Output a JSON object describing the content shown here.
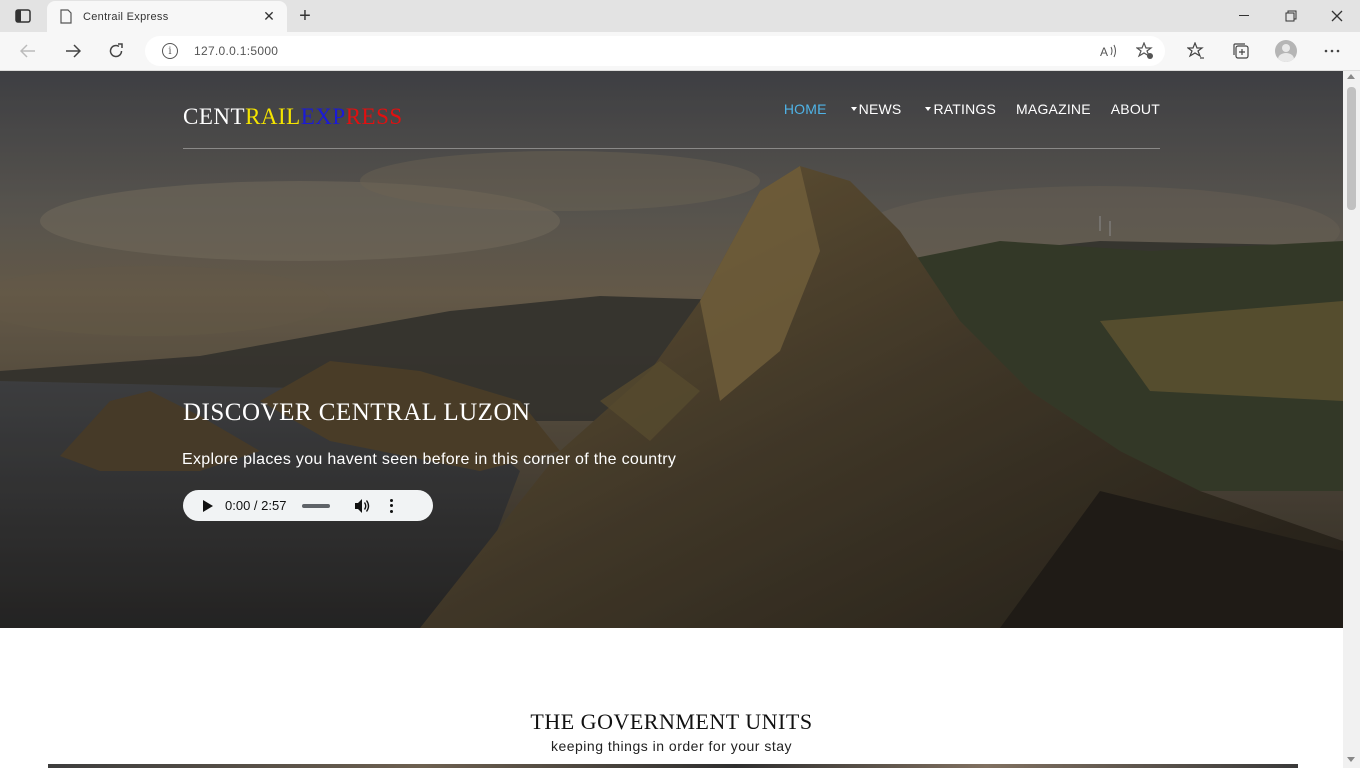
{
  "browser": {
    "tab_title": "Centrail Express",
    "url": "127.0.0.1:5000",
    "tab_close": "✕",
    "new_tab": "+"
  },
  "nav": {
    "logo_parts": [
      "CENT",
      "RAIL",
      "EXP",
      "RESS"
    ],
    "items": [
      {
        "label": "HOME",
        "active": true,
        "dropdown": false
      },
      {
        "label": "NEWS",
        "active": false,
        "dropdown": true
      },
      {
        "label": "RATINGS",
        "active": false,
        "dropdown": true
      },
      {
        "label": "MAGAZINE",
        "active": false,
        "dropdown": false
      },
      {
        "label": "ABOUT",
        "active": false,
        "dropdown": false
      }
    ]
  },
  "hero": {
    "title": "DISCOVER CENTRAL LUZON",
    "subtitle": "Explore places you havent seen before in this corner of the country",
    "audio_time": "0:00 / 2:57",
    "audio_progress": 0
  },
  "section": {
    "title": "THE GOVERNMENT UNITS",
    "subtitle": "keeping things in order for your stay"
  },
  "colors": {
    "active_nav": "#4fb3e6",
    "logo_yellow": "#f4e400",
    "logo_blue": "#1a1ad8",
    "logo_red": "#e01010"
  }
}
